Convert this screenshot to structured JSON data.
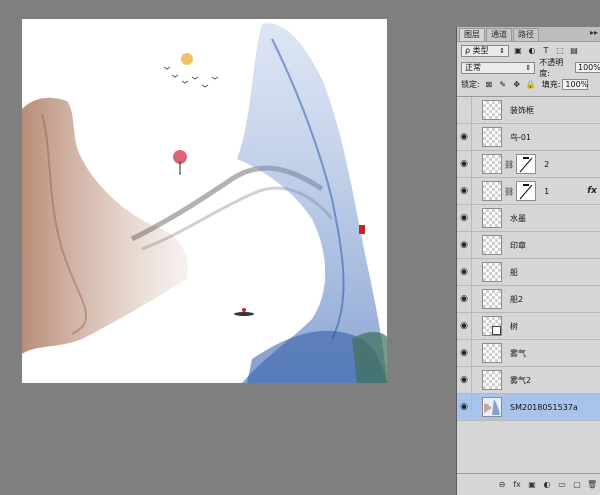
{
  "panel": {
    "tabs": [
      "图层",
      "通道",
      "路径"
    ],
    "active_tab": "图层",
    "menu_icon": "double-chevron-icon",
    "filter_label": "ρ 类型",
    "blend_mode": "正常",
    "opacity_label": "不透明度:",
    "opacity_value": "100%",
    "lock_label": "锁定:",
    "fill_label": "填充:",
    "fill_value": "100%"
  },
  "layers": [
    {
      "name": "装饰框",
      "visible": false
    },
    {
      "name": "鸟-01",
      "visible": true
    },
    {
      "name": "2",
      "visible": true,
      "mask": true
    },
    {
      "name": "1",
      "visible": true,
      "mask": true,
      "fx": "fx"
    },
    {
      "name": "水墨",
      "visible": true
    },
    {
      "name": "印章",
      "visible": true
    },
    {
      "name": "船",
      "visible": true
    },
    {
      "name": "船2",
      "visible": true
    },
    {
      "name": "树",
      "visible": true,
      "smart": true
    },
    {
      "name": "雾气",
      "visible": true
    },
    {
      "name": "雾气2",
      "visible": true
    },
    {
      "name": "SM2018051537a",
      "visible": true,
      "selected": true
    }
  ],
  "bottom_icons": [
    "link-icon",
    "fx-icon",
    "mask-icon",
    "adjustment-icon",
    "group-folder-icon",
    "new-layer-icon",
    "trash-icon"
  ],
  "bottom_glyphs": [
    "⊖",
    "fx",
    "▣",
    "◐",
    "▭",
    "▢",
    "🗑"
  ],
  "colors": {
    "ink_blue": "#5b7fc1",
    "ink_brown": "#a9775e",
    "selection": "#a8c4ea"
  }
}
